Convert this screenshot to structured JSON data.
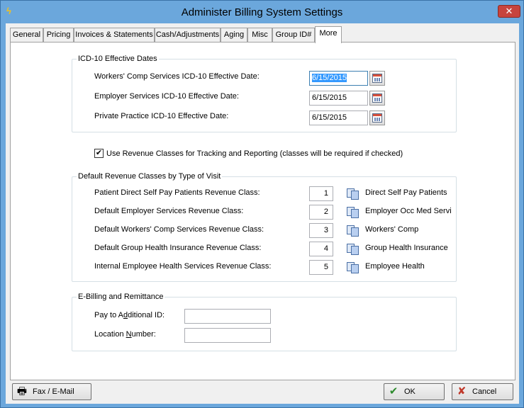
{
  "window": {
    "title": "Administer Billing System Settings",
    "close_glyph": "✕",
    "app_icon": "lightning-icon"
  },
  "tabs": [
    {
      "label": "General"
    },
    {
      "label": "Pricing"
    },
    {
      "label": "Invoices & Statements"
    },
    {
      "label": "Cash/Adjustments"
    },
    {
      "label": "Aging"
    },
    {
      "label": "Misc"
    },
    {
      "label": "Group ID#"
    },
    {
      "label": "More",
      "active": true
    }
  ],
  "icd10": {
    "group_title": "ICD-10 Effective Dates",
    "rows": [
      {
        "label": "Workers' Comp Services ICD-10 Effective Date:",
        "value": "6/15/2015"
      },
      {
        "label": "Employer Services ICD-10 Effective Date:",
        "value": "6/15/2015"
      },
      {
        "label": "Private Practice ICD-10 Effective Date:",
        "value": "6/15/2015"
      }
    ]
  },
  "revenue_checkbox": {
    "checked": true,
    "mark": "✔",
    "label": "Use Revenue Classes for Tracking and Reporting (classes will be required if checked)"
  },
  "revenue": {
    "group_title": "Default Revenue Classes by Type of Visit",
    "rows": [
      {
        "label": "Patient Direct Self Pay Patients Revenue Class:",
        "value": "1",
        "desc": "Direct Self Pay Patients"
      },
      {
        "label": "Default Employer Services Revenue Class:",
        "value": "2",
        "desc": "Employer Occ Med Servi"
      },
      {
        "label": "Default Workers' Comp Services Revenue Class:",
        "value": "3",
        "desc": "Workers' Comp"
      },
      {
        "label": "Default Group Health Insurance Revenue Class:",
        "value": "4",
        "desc": "Group Health Insurance"
      },
      {
        "label": "Internal Employee Health Services Revenue Class:",
        "value": "5",
        "desc": "Employee Health"
      }
    ]
  },
  "ebilling": {
    "group_title": "E-Billing and Remittance",
    "pay_to_label_pre": "Pay to A",
    "pay_to_label_ul": "d",
    "pay_to_label_post": "ditional ID:",
    "pay_to_value": "",
    "location_label_pre": "Location ",
    "location_label_ul": "N",
    "location_label_post": "umber:",
    "location_value": ""
  },
  "footer": {
    "fax_label": "Fax / E-Mail",
    "ok_label": "OK",
    "cancel_label": "Cancel",
    "ok_color": "#2e8b2e",
    "cancel_color": "#c0392b"
  }
}
